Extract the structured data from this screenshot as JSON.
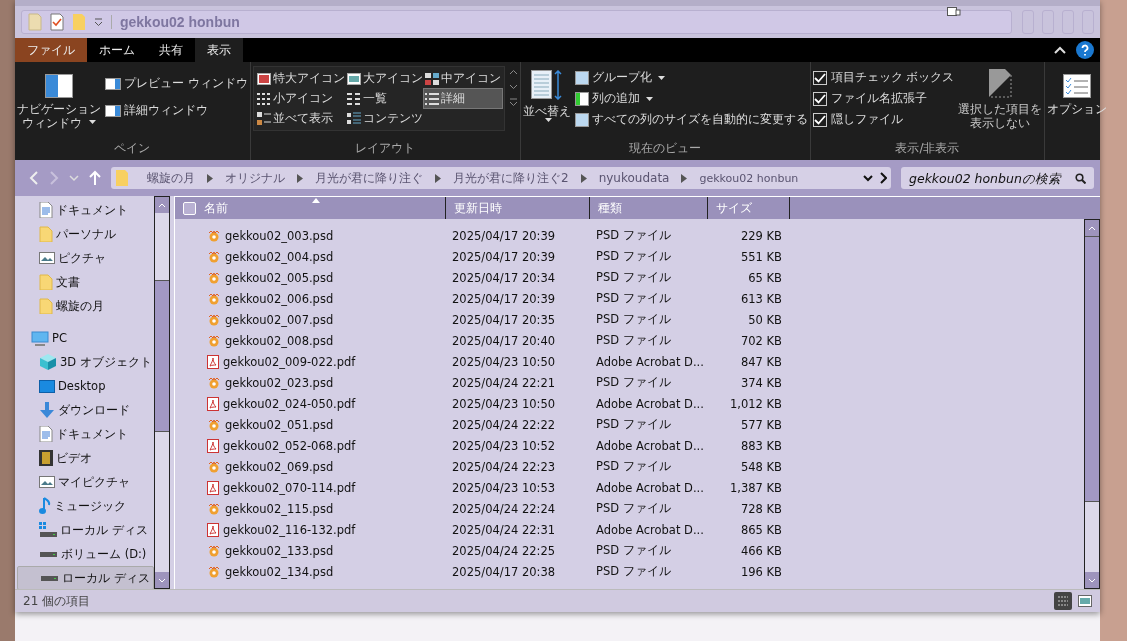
{
  "window": {
    "title": "gekkou02 honbun"
  },
  "ribbon_tabs": [
    {
      "label": "ファイル",
      "kind": "file",
      "selected": false
    },
    {
      "label": "ホーム",
      "kind": "tab",
      "selected": false
    },
    {
      "label": "共有",
      "kind": "tab",
      "selected": false
    },
    {
      "label": "表示",
      "kind": "tab",
      "selected": true
    }
  ],
  "ribbon": {
    "pane": {
      "label": "ペイン",
      "navigation_line1": "ナビゲーション",
      "navigation_line2": "ウィンドウ",
      "items": [
        "プレビュー ウィンドウ",
        "詳細ウィンドウ"
      ]
    },
    "layout": {
      "label": "レイアウト",
      "items": [
        {
          "label": "特大アイコン",
          "kind": "xl",
          "selected": false
        },
        {
          "label": "大アイコン",
          "kind": "large",
          "selected": false
        },
        {
          "label": "中アイコン",
          "kind": "medium",
          "selected": false
        },
        {
          "label": "小アイコン",
          "kind": "small",
          "selected": false
        },
        {
          "label": "一覧",
          "kind": "list",
          "selected": false
        },
        {
          "label": "詳細",
          "kind": "details",
          "selected": true
        },
        {
          "label": "並べて表示",
          "kind": "tiles",
          "selected": false
        },
        {
          "label": "コンテンツ",
          "kind": "content",
          "selected": false
        }
      ]
    },
    "current_view": {
      "label": "現在のビュー",
      "sort": "並べ替え",
      "items": [
        "グループ化",
        "列の追加",
        "すべての列のサイズを自動的に変更する"
      ]
    },
    "show_hide": {
      "label": "表示/非表示",
      "checks": [
        {
          "label": "項目チェック ボックス",
          "checked": true
        },
        {
          "label": "ファイル名拡張子",
          "checked": true
        },
        {
          "label": "隠しファイル",
          "checked": true
        }
      ],
      "hide_line1": "選択した項目を",
      "hide_line2": "表示しない"
    },
    "options": "オプション"
  },
  "address": {
    "path": [
      "螺旋の月",
      "オリジナル",
      "月光が君に降り注ぐ",
      "月光が君に降り注ぐ2",
      "nyukoudata",
      "gekkou02 honbun"
    ],
    "search_placeholder": "gekkou02 honbunの検索"
  },
  "sidebar": {
    "items": [
      {
        "label": "ドキュメント",
        "kind": "doc",
        "selected": false
      },
      {
        "label": "パーソナル",
        "kind": "folder",
        "selected": false
      },
      {
        "label": "ピクチャ",
        "kind": "picture",
        "selected": false
      },
      {
        "label": "文書",
        "kind": "folder",
        "selected": false
      },
      {
        "label": "螺旋の月",
        "kind": "folder",
        "selected": false
      },
      {
        "label": "PC",
        "kind": "pc",
        "selected": false,
        "children": [
          {
            "label": "3D オブジェクト",
            "kind": "cube",
            "selected": false
          },
          {
            "label": "Desktop",
            "kind": "desktop",
            "selected": false
          },
          {
            "label": "ダウンロード",
            "kind": "download",
            "selected": false
          },
          {
            "label": "ドキュメント",
            "kind": "doc",
            "selected": false
          },
          {
            "label": "ビデオ",
            "kind": "video",
            "selected": false
          },
          {
            "label": "マイピクチャ",
            "kind": "picture",
            "selected": false
          },
          {
            "label": "ミュージック",
            "kind": "music",
            "selected": false
          },
          {
            "label": "ローカル ディス",
            "kind": "windrive",
            "selected": false
          },
          {
            "label": "ボリューム (D:)",
            "kind": "drive",
            "selected": false
          },
          {
            "label": "ローカル ディス",
            "kind": "drive",
            "selected": true
          }
        ]
      }
    ]
  },
  "table": {
    "columns": [
      "名前",
      "更新日時",
      "種類",
      "サイズ"
    ],
    "select_all": {
      "checked": false
    },
    "rows": [
      {
        "name": "gekkou02_003.psd",
        "kind": "psd",
        "date": "2025/04/17 20:39",
        "type": "PSD ファイル",
        "size": "229 KB"
      },
      {
        "name": "gekkou02_004.psd",
        "kind": "psd",
        "date": "2025/04/17 20:39",
        "type": "PSD ファイル",
        "size": "551 KB"
      },
      {
        "name": "gekkou02_005.psd",
        "kind": "psd",
        "date": "2025/04/17 20:34",
        "type": "PSD ファイル",
        "size": "65 KB"
      },
      {
        "name": "gekkou02_006.psd",
        "kind": "psd",
        "date": "2025/04/17 20:39",
        "type": "PSD ファイル",
        "size": "613 KB"
      },
      {
        "name": "gekkou02_007.psd",
        "kind": "psd",
        "date": "2025/04/17 20:35",
        "type": "PSD ファイル",
        "size": "50 KB"
      },
      {
        "name": "gekkou02_008.psd",
        "kind": "psd",
        "date": "2025/04/17 20:40",
        "type": "PSD ファイル",
        "size": "702 KB"
      },
      {
        "name": "gekkou02_009-022.pdf",
        "kind": "pdf",
        "date": "2025/04/23 10:50",
        "type": "Adobe Acrobat D...",
        "size": "847 KB"
      },
      {
        "name": "gekkou02_023.psd",
        "kind": "psd",
        "date": "2025/04/24 22:21",
        "type": "PSD ファイル",
        "size": "374 KB"
      },
      {
        "name": "gekkou02_024-050.pdf",
        "kind": "pdf",
        "date": "2025/04/23 10:50",
        "type": "Adobe Acrobat D...",
        "size": "1,012 KB"
      },
      {
        "name": "gekkou02_051.psd",
        "kind": "psd",
        "date": "2025/04/24 22:22",
        "type": "PSD ファイル",
        "size": "577 KB"
      },
      {
        "name": "gekkou02_052-068.pdf",
        "kind": "pdf",
        "date": "2025/04/23 10:52",
        "type": "Adobe Acrobat D...",
        "size": "883 KB"
      },
      {
        "name": "gekkou02_069.psd",
        "kind": "psd",
        "date": "2025/04/24 22:23",
        "type": "PSD ファイル",
        "size": "548 KB"
      },
      {
        "name": "gekkou02_070-114.pdf",
        "kind": "pdf",
        "date": "2025/04/23 10:53",
        "type": "Adobe Acrobat D...",
        "size": "1,387 KB"
      },
      {
        "name": "gekkou02_115.psd",
        "kind": "psd",
        "date": "2025/04/24 22:24",
        "type": "PSD ファイル",
        "size": "728 KB"
      },
      {
        "name": "gekkou02_116-132.pdf",
        "kind": "pdf",
        "date": "2025/04/24 22:31",
        "type": "Adobe Acrobat D...",
        "size": "865 KB"
      },
      {
        "name": "gekkou02_133.psd",
        "kind": "psd",
        "date": "2025/04/24 22:25",
        "type": "PSD ファイル",
        "size": "466 KB"
      },
      {
        "name": "gekkou02_134.psd",
        "kind": "psd",
        "date": "2025/04/17 20:38",
        "type": "PSD ファイル",
        "size": "196 KB"
      }
    ]
  },
  "status_bar": {
    "count": "21 個の項目"
  }
}
